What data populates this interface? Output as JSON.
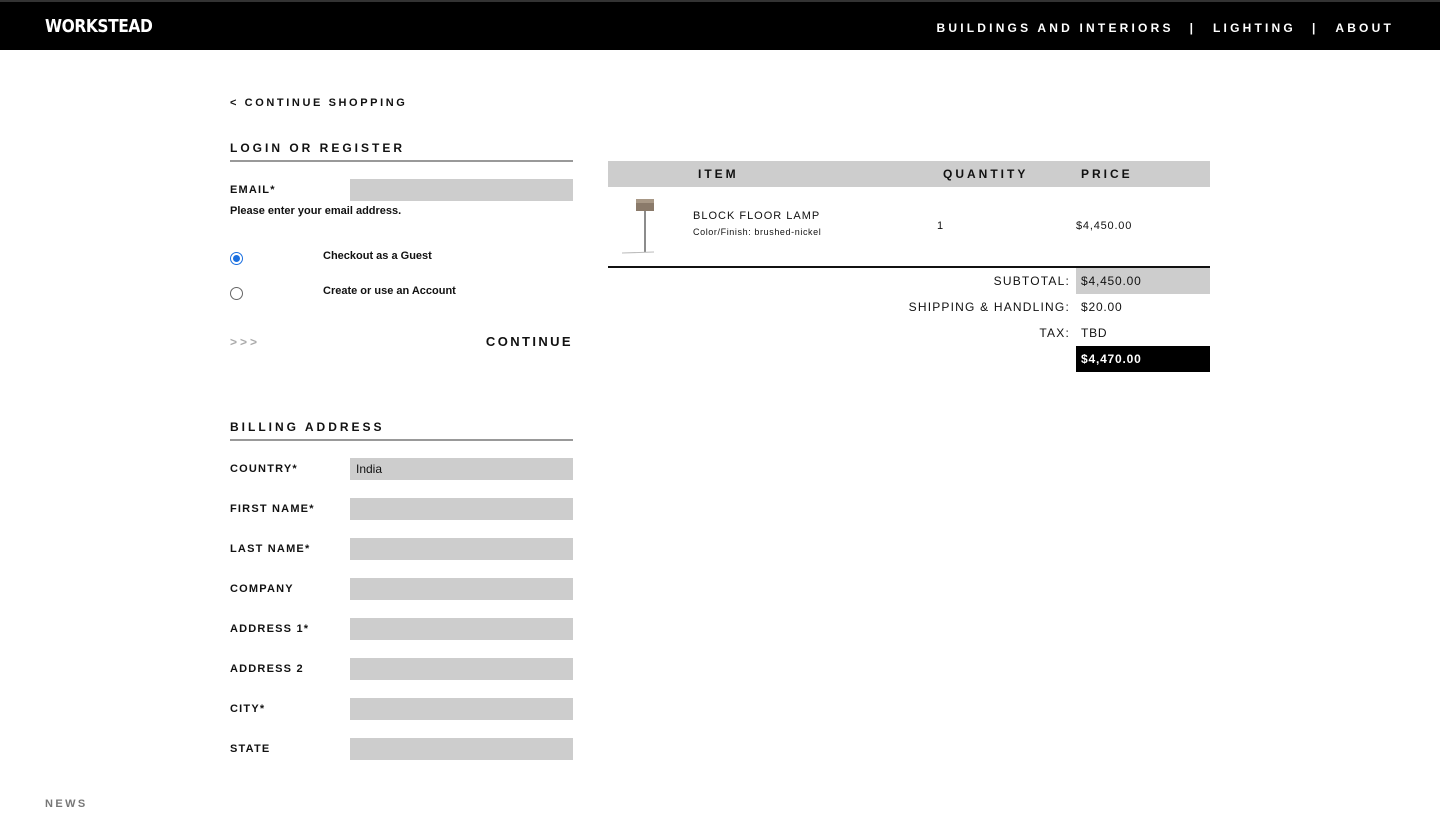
{
  "header": {
    "logo": "WORKSTEAD",
    "nav": [
      "BUILDINGS AND INTERIORS",
      "LIGHTING",
      "ABOUT"
    ],
    "separator": "|"
  },
  "continue_shopping": "< CONTINUE SHOPPING",
  "login": {
    "title": "LOGIN OR REGISTER",
    "email_label": "EMAIL*",
    "email_value": "",
    "email_help": "Please enter your email address.",
    "options": [
      "Checkout as a Guest",
      "Create or use an Account"
    ],
    "selected_option": "Checkout as a Guest",
    "arrows": ">>>",
    "continue_label": "CONTINUE"
  },
  "billing": {
    "title": "BILLING ADDRESS",
    "fields": [
      {
        "label": "COUNTRY*",
        "value": "India"
      },
      {
        "label": "FIRST NAME*",
        "value": ""
      },
      {
        "label": "LAST NAME*",
        "value": ""
      },
      {
        "label": "COMPANY",
        "value": ""
      },
      {
        "label": "ADDRESS 1*",
        "value": ""
      },
      {
        "label": "ADDRESS 2",
        "value": ""
      },
      {
        "label": "CITY*",
        "value": ""
      },
      {
        "label": "STATE",
        "value": ""
      }
    ]
  },
  "cart": {
    "headers": {
      "item": "ITEM",
      "quantity": "QUANTITY",
      "price": "PRICE"
    },
    "items": [
      {
        "name": "BLOCK FLOOR LAMP",
        "finish": "Color/Finish: brushed-nickel",
        "quantity": "1",
        "price": "$4,450.00",
        "image_icon": "floor-lamp-icon"
      }
    ],
    "summary": {
      "subtotal_label": "SUBTOTAL:",
      "subtotal_value": "$4,450.00",
      "shipping_label": "SHIPPING & HANDLING:",
      "shipping_value": "$20.00",
      "tax_label": "TAX:",
      "tax_value": "TBD",
      "total_value": "$4,470.00"
    }
  },
  "footer": {
    "news": "NEWS"
  }
}
